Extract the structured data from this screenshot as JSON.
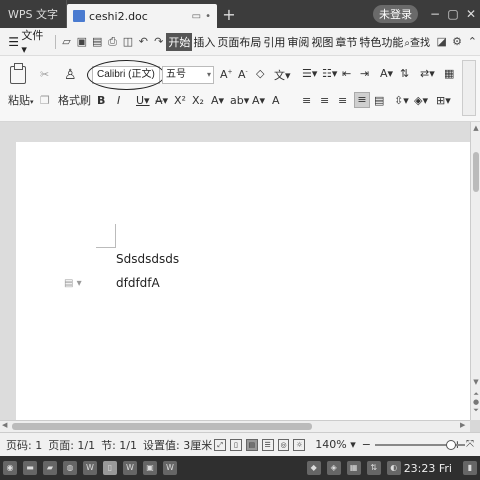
{
  "titlebar": {
    "app_name": "WPS 文字",
    "doc_name": "ceshi2.doc",
    "login_label": "未登录"
  },
  "menubar": {
    "file_label": "文件",
    "tabs": [
      "开始",
      "插入",
      "页面布局",
      "引用",
      "审阅",
      "视图",
      "章节",
      "特色功能"
    ],
    "search_label": "查找"
  },
  "ribbon": {
    "paste_label": "粘贴",
    "format_painter_label": "格式刷",
    "font_name": "Calibri (正文)",
    "font_size": "五号"
  },
  "document": {
    "lines": [
      "Sdsdsdsds",
      "dfdfdfA"
    ]
  },
  "statusbar": {
    "page_code": "页码: 1",
    "pages": "页面: 1/1",
    "section": "节: 1/1",
    "setting": "设置值: 3厘米",
    "zoom": "140%",
    "zoom_minus": "−",
    "zoom_plus": "+"
  },
  "taskbar": {
    "clock": "23:23 Fri"
  }
}
